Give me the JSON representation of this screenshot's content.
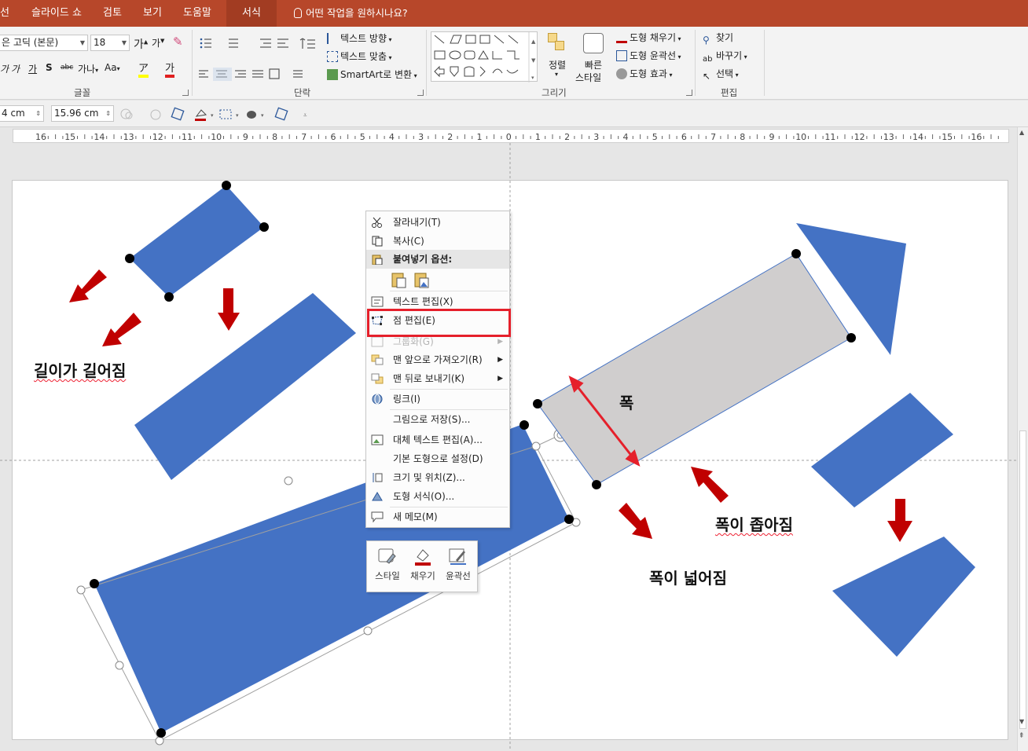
{
  "tabs": [
    {
      "label": "선",
      "active": false
    },
    {
      "label": "슬라이드 쇼",
      "active": false
    },
    {
      "label": "검토",
      "active": false
    },
    {
      "label": "보기",
      "active": false
    },
    {
      "label": "도움말",
      "active": false
    },
    {
      "label": "서식",
      "active": true
    }
  ],
  "tell_me": "어떤 작업을 원하시나요?",
  "ribbon": {
    "font": {
      "name_value": "은 고딕 (본문)",
      "size_value": "18",
      "group_label": "글꼴"
    },
    "paragraph": {
      "text_direction": "텍스트 방향",
      "align_text": "텍스트 맞춤",
      "smartart": "SmartArt로 변환",
      "group_label": "단락"
    },
    "drawing": {
      "arrange": "정렬",
      "quick_styles_line1": "빠른",
      "quick_styles_line2": "스타일",
      "shape_fill": "도형 채우기",
      "shape_outline": "도형 윤곽선",
      "shape_effects": "도형 효과",
      "group_label": "그리기"
    },
    "editing": {
      "find": "찾기",
      "replace": "바꾸기",
      "select": "선택",
      "group_label": "편집"
    }
  },
  "format_bar": {
    "height_value": "4 cm",
    "width_value": "15.96 cm"
  },
  "ruler": {
    "labels": [
      "16",
      "15",
      "14",
      "13",
      "12",
      "11",
      "10",
      "9",
      "8",
      "7",
      "6",
      "5",
      "4",
      "3",
      "2",
      "1",
      "0",
      "1",
      "2",
      "3",
      "4",
      "5",
      "6",
      "7",
      "8",
      "9",
      "10",
      "11",
      "12",
      "13",
      "14",
      "15",
      "16"
    ]
  },
  "slide": {
    "label_length": "길이가 길어짐",
    "label_width": "폭",
    "label_narrow": "폭이 좁아짐",
    "label_wide": "폭이 넓어짐",
    "colors": {
      "shape_blue": "#4472c4",
      "shape_gray": "#d0cece",
      "arrow_red": "#c00000",
      "highlight_red": "#e5202b"
    }
  },
  "context_menu": {
    "items": [
      {
        "label": "잘라내기(T)",
        "icon": "scissors-icon",
        "disabled": false
      },
      {
        "label": "복사(C)",
        "icon": "copy-icon",
        "disabled": false
      },
      {
        "label": "붙여넣기 옵션:",
        "icon": "paste-icon",
        "disabled": false,
        "header": true
      },
      {
        "label": "텍스트 편집(X)",
        "icon": "text-edit-icon",
        "disabled": false
      },
      {
        "label": "점 편집(E)",
        "icon": "edit-points-icon",
        "disabled": false
      },
      {
        "label": "그룹화(G)",
        "icon": "group-icon",
        "disabled": true
      },
      {
        "label": "맨 앞으로 가져오기(R)",
        "icon": "bring-front-icon",
        "disabled": false,
        "submenu": true
      },
      {
        "label": "맨 뒤로 보내기(K)",
        "icon": "send-back-icon",
        "disabled": false,
        "submenu": true
      },
      {
        "label": "링크(I)",
        "icon": "link-icon",
        "disabled": false
      },
      {
        "label": "그림으로 저장(S)...",
        "icon": "",
        "disabled": false
      },
      {
        "label": "대체 텍스트 편집(A)...",
        "icon": "alt-text-icon",
        "disabled": false
      },
      {
        "label": "기본 도형으로 설정(D)",
        "icon": "",
        "disabled": false
      },
      {
        "label": "크기 및 위치(Z)...",
        "icon": "size-position-icon",
        "disabled": false
      },
      {
        "label": "도형 서식(O)...",
        "icon": "format-shape-icon",
        "disabled": false
      },
      {
        "label": "새 메모(M)",
        "icon": "comment-icon",
        "disabled": false
      }
    ]
  },
  "mini_toolbar": {
    "style": "스타일",
    "fill": "채우기",
    "outline": "윤곽선"
  }
}
